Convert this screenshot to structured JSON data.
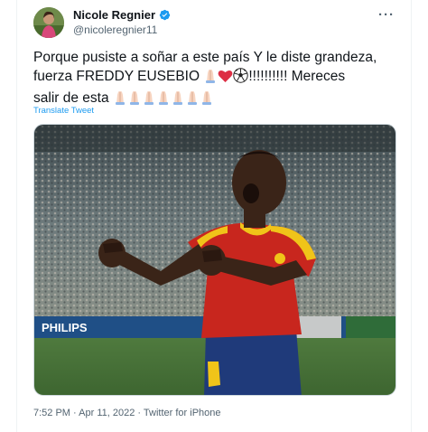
{
  "author": {
    "display_name": "Nicole Regnier",
    "handle": "@nicoleregnier11",
    "verified": true,
    "avatar_icon": "profile-photo"
  },
  "menu_icon": "more-horizontal-icon",
  "tweet": {
    "line1": "Porque pusiste a soñar a este país Y le diste grandeza,",
    "line2_start": "fuerza FREDDY EUSEBIO ",
    "line2_end": "!!!!!!!!!! Mereces",
    "line3": "salir de esta ",
    "translate_label": "Translate Tweet"
  },
  "media": {
    "icon": "photo-soccer-player-celebrating",
    "ad_board_text": "PHILIPS"
  },
  "metadata": {
    "time": "7:52 PM",
    "separator1": " · ",
    "date": "Apr 11, 2022",
    "separator2": " · ",
    "source": "Twitter for iPhone"
  },
  "colors": {
    "link": "#1d9bf0",
    "secondary_text": "#536471",
    "verified": "#1d9bf0",
    "jersey_red": "#c8261e",
    "jersey_yellow": "#f0c419",
    "shorts_blue": "#1f3a7a"
  }
}
